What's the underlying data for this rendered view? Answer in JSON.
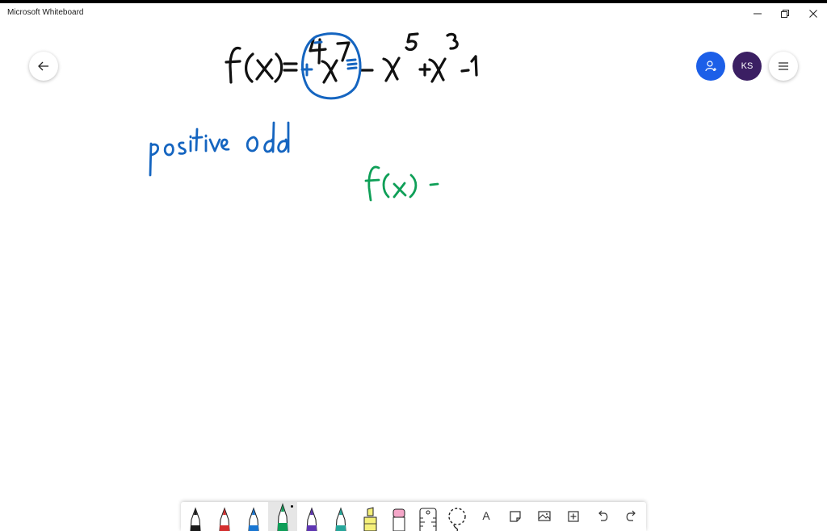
{
  "window": {
    "title": "Microsoft Whiteboard"
  },
  "header": {
    "avatar_initials": "KS",
    "colors": {
      "invite": "#1c5fe8",
      "avatar": "#3b1f63"
    }
  },
  "canvas": {
    "ink": {
      "equation": "f(x)=+4x⁷-x⁵+x³-1",
      "note": "positive odd",
      "partial": "f(x)-"
    },
    "ink_colors": {
      "black": "#111111",
      "blue": "#1565c0",
      "green": "#0e9f57"
    }
  },
  "toolbar": {
    "tools": [
      {
        "name": "black-pen",
        "color": "#1a1a1a"
      },
      {
        "name": "red-pen",
        "color": "#d32f2f"
      },
      {
        "name": "blue-pen",
        "color": "#1976d2"
      },
      {
        "name": "green-pen",
        "color": "#0f9d58",
        "selected": true
      },
      {
        "name": "purple-pen",
        "color": "#5e35b1"
      },
      {
        "name": "teal-pen",
        "color": "#26a69a"
      },
      {
        "name": "highlighter",
        "color": "#f5f07a"
      },
      {
        "name": "eraser",
        "color": "#f4a6c8"
      },
      {
        "name": "ruler",
        "color": "#ffffff"
      },
      {
        "name": "lasso",
        "color": "#ffffff"
      }
    ],
    "text_tool_glyph": "A",
    "actions": [
      "sticky-note",
      "image",
      "add",
      "undo",
      "redo"
    ]
  }
}
